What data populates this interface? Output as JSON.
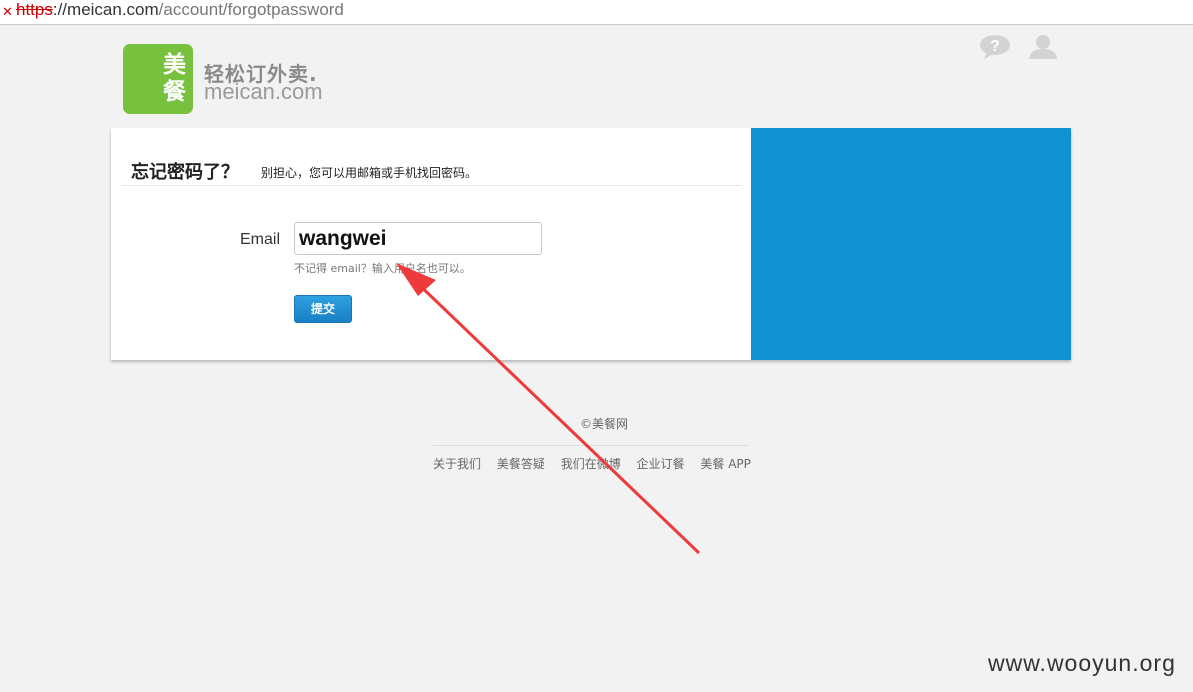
{
  "address_bar": {
    "protocol": "https",
    "host_path": "://meican.com",
    "path": "/account/forgotpassword"
  },
  "logo": {
    "char1": "美",
    "char2": "餐",
    "slogan": "轻松订外卖.",
    "domain": "meican.com"
  },
  "header_icons": [
    "help-icon",
    "user-icon"
  ],
  "form": {
    "title": "忘记密码了？",
    "subtitle": "别担心，您可以用邮箱或手机找回密码。",
    "email_label": "Email",
    "email_value": "wangwei",
    "hint": "不记得 email？输入用户名也可以。",
    "submit_label": "提交"
  },
  "colors": {
    "brand_green": "#78c13f",
    "panel_blue": "#1192d1",
    "arrow_red": "#ee3a3a"
  },
  "footer": {
    "copyright": "美餐网",
    "links": [
      "关于我们",
      "美餐答疑",
      "我们在微博",
      "企业订餐",
      "美餐 APP"
    ]
  },
  "watermark": "www.wooyun.org"
}
